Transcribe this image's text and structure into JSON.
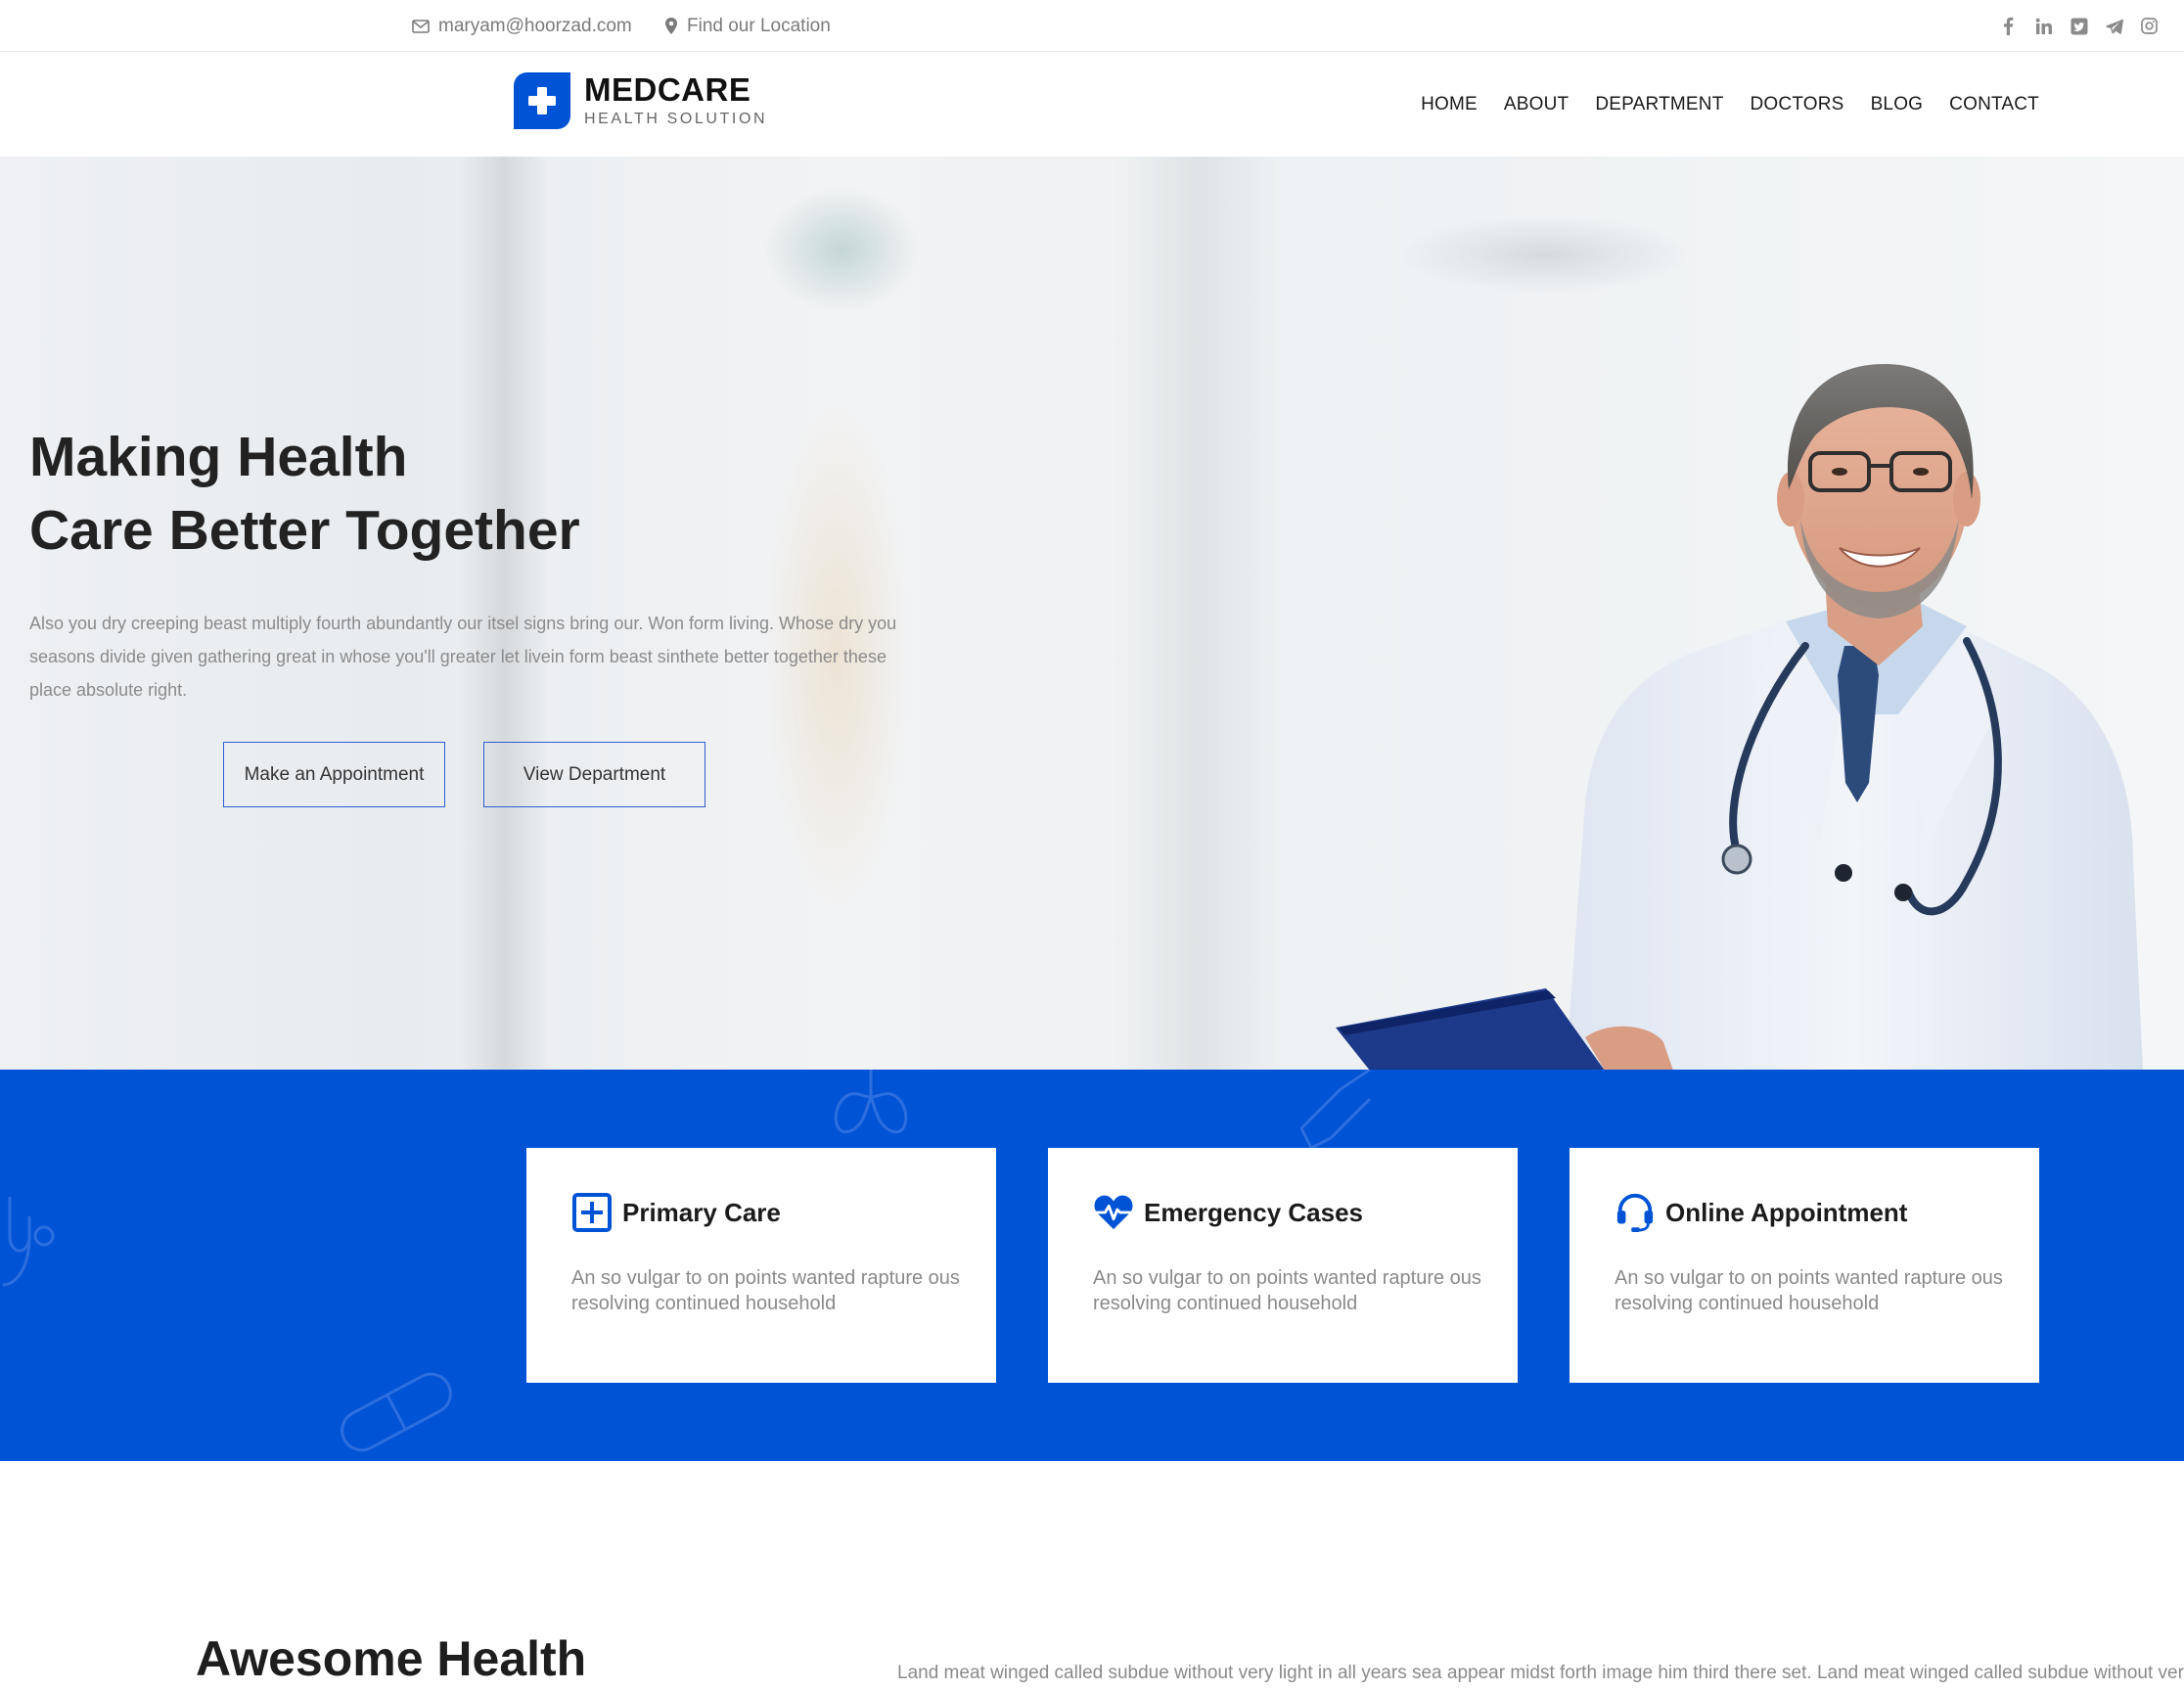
{
  "topbar": {
    "email": "maryam@hoorzad.com",
    "location": "Find our Location",
    "socials": [
      "facebook-icon",
      "linkedin-icon",
      "twitter-icon",
      "telegram-icon",
      "instagram-icon"
    ]
  },
  "brand": {
    "name": "MEDCARE",
    "tagline": "HEALTH SOLUTION",
    "color": "#0153d6"
  },
  "nav": {
    "items": [
      "HOME",
      "ABOUT",
      "DEPARTMENT",
      "DOCTORS",
      "BLOG",
      "CONTACT"
    ]
  },
  "hero": {
    "title_line1": "Making Health",
    "title_line2": "Care Better Together",
    "description": "Also you dry creeping beast multiply fourth abundantly our itsel signs bring our. Won form living. Whose dry you seasons divide given gathering great in whose you'll greater let livein form beast sinthete better together these place absolute right.",
    "button_appointment": "Make an Appointment",
    "button_department": "View Department"
  },
  "features": [
    {
      "icon": "plus-square-icon",
      "title": "Primary Care",
      "text": "An so vulgar to on points wanted rapture ous resolving continued household"
    },
    {
      "icon": "heartbeat-icon",
      "title": "Emergency Cases",
      "text": "An so vulgar to on points wanted rapture ous resolving continued household"
    },
    {
      "icon": "headset-icon",
      "title": "Online Appointment",
      "text": "An so vulgar to on points wanted rapture ous resolving continued household"
    }
  ],
  "about": {
    "title": "Awesome Health",
    "text": "Land meat winged called subdue without very light in all years sea appear midst forth image him third there set. Land meat winged called subdue without very li"
  }
}
